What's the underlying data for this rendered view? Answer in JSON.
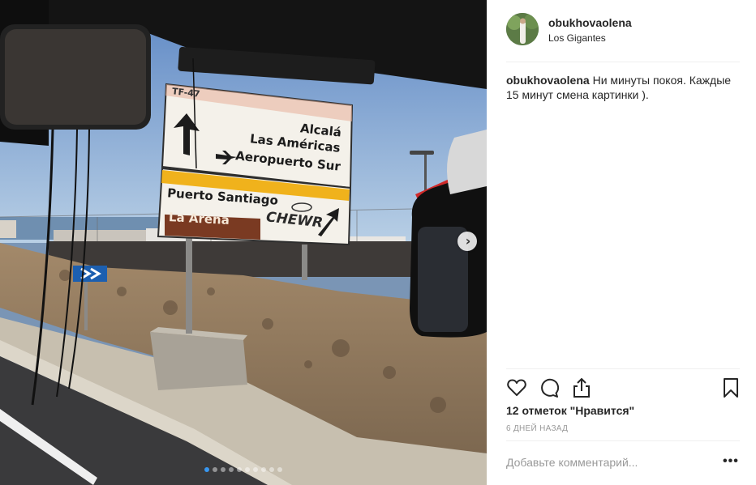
{
  "photo": {
    "alt": "",
    "sign_route": "TF-47",
    "sign_top_lines": [
      "Alcalá",
      "Las Américas",
      "Aeropuerto Sur"
    ],
    "sign_bottom_line1": "Puerto Santiago",
    "sign_bottom_line2": "La Arena",
    "graffiti": "CHEWR",
    "carousel_count": 10,
    "carousel_active_index": 0
  },
  "post": {
    "username": "obukhovaolena",
    "location": "Los Gigantes",
    "caption_user": "obukhovaolena",
    "caption_text": "Ни минуты покоя. Каждые 15 минут смена картинки ).",
    "likes": "12 отметок \"Нравится\"",
    "time": "6 дней назад",
    "comment_placeholder": "Добавьте комментарий...",
    "more_label": "•••"
  },
  "icons": {
    "like": "heart-icon",
    "comment": "comment-icon",
    "share": "share-icon",
    "save": "bookmark-icon",
    "next": "chevron-right-icon"
  },
  "colors": {
    "accent": "#3897f0",
    "text": "#262626",
    "muted": "#999999",
    "divider": "#efefef"
  }
}
